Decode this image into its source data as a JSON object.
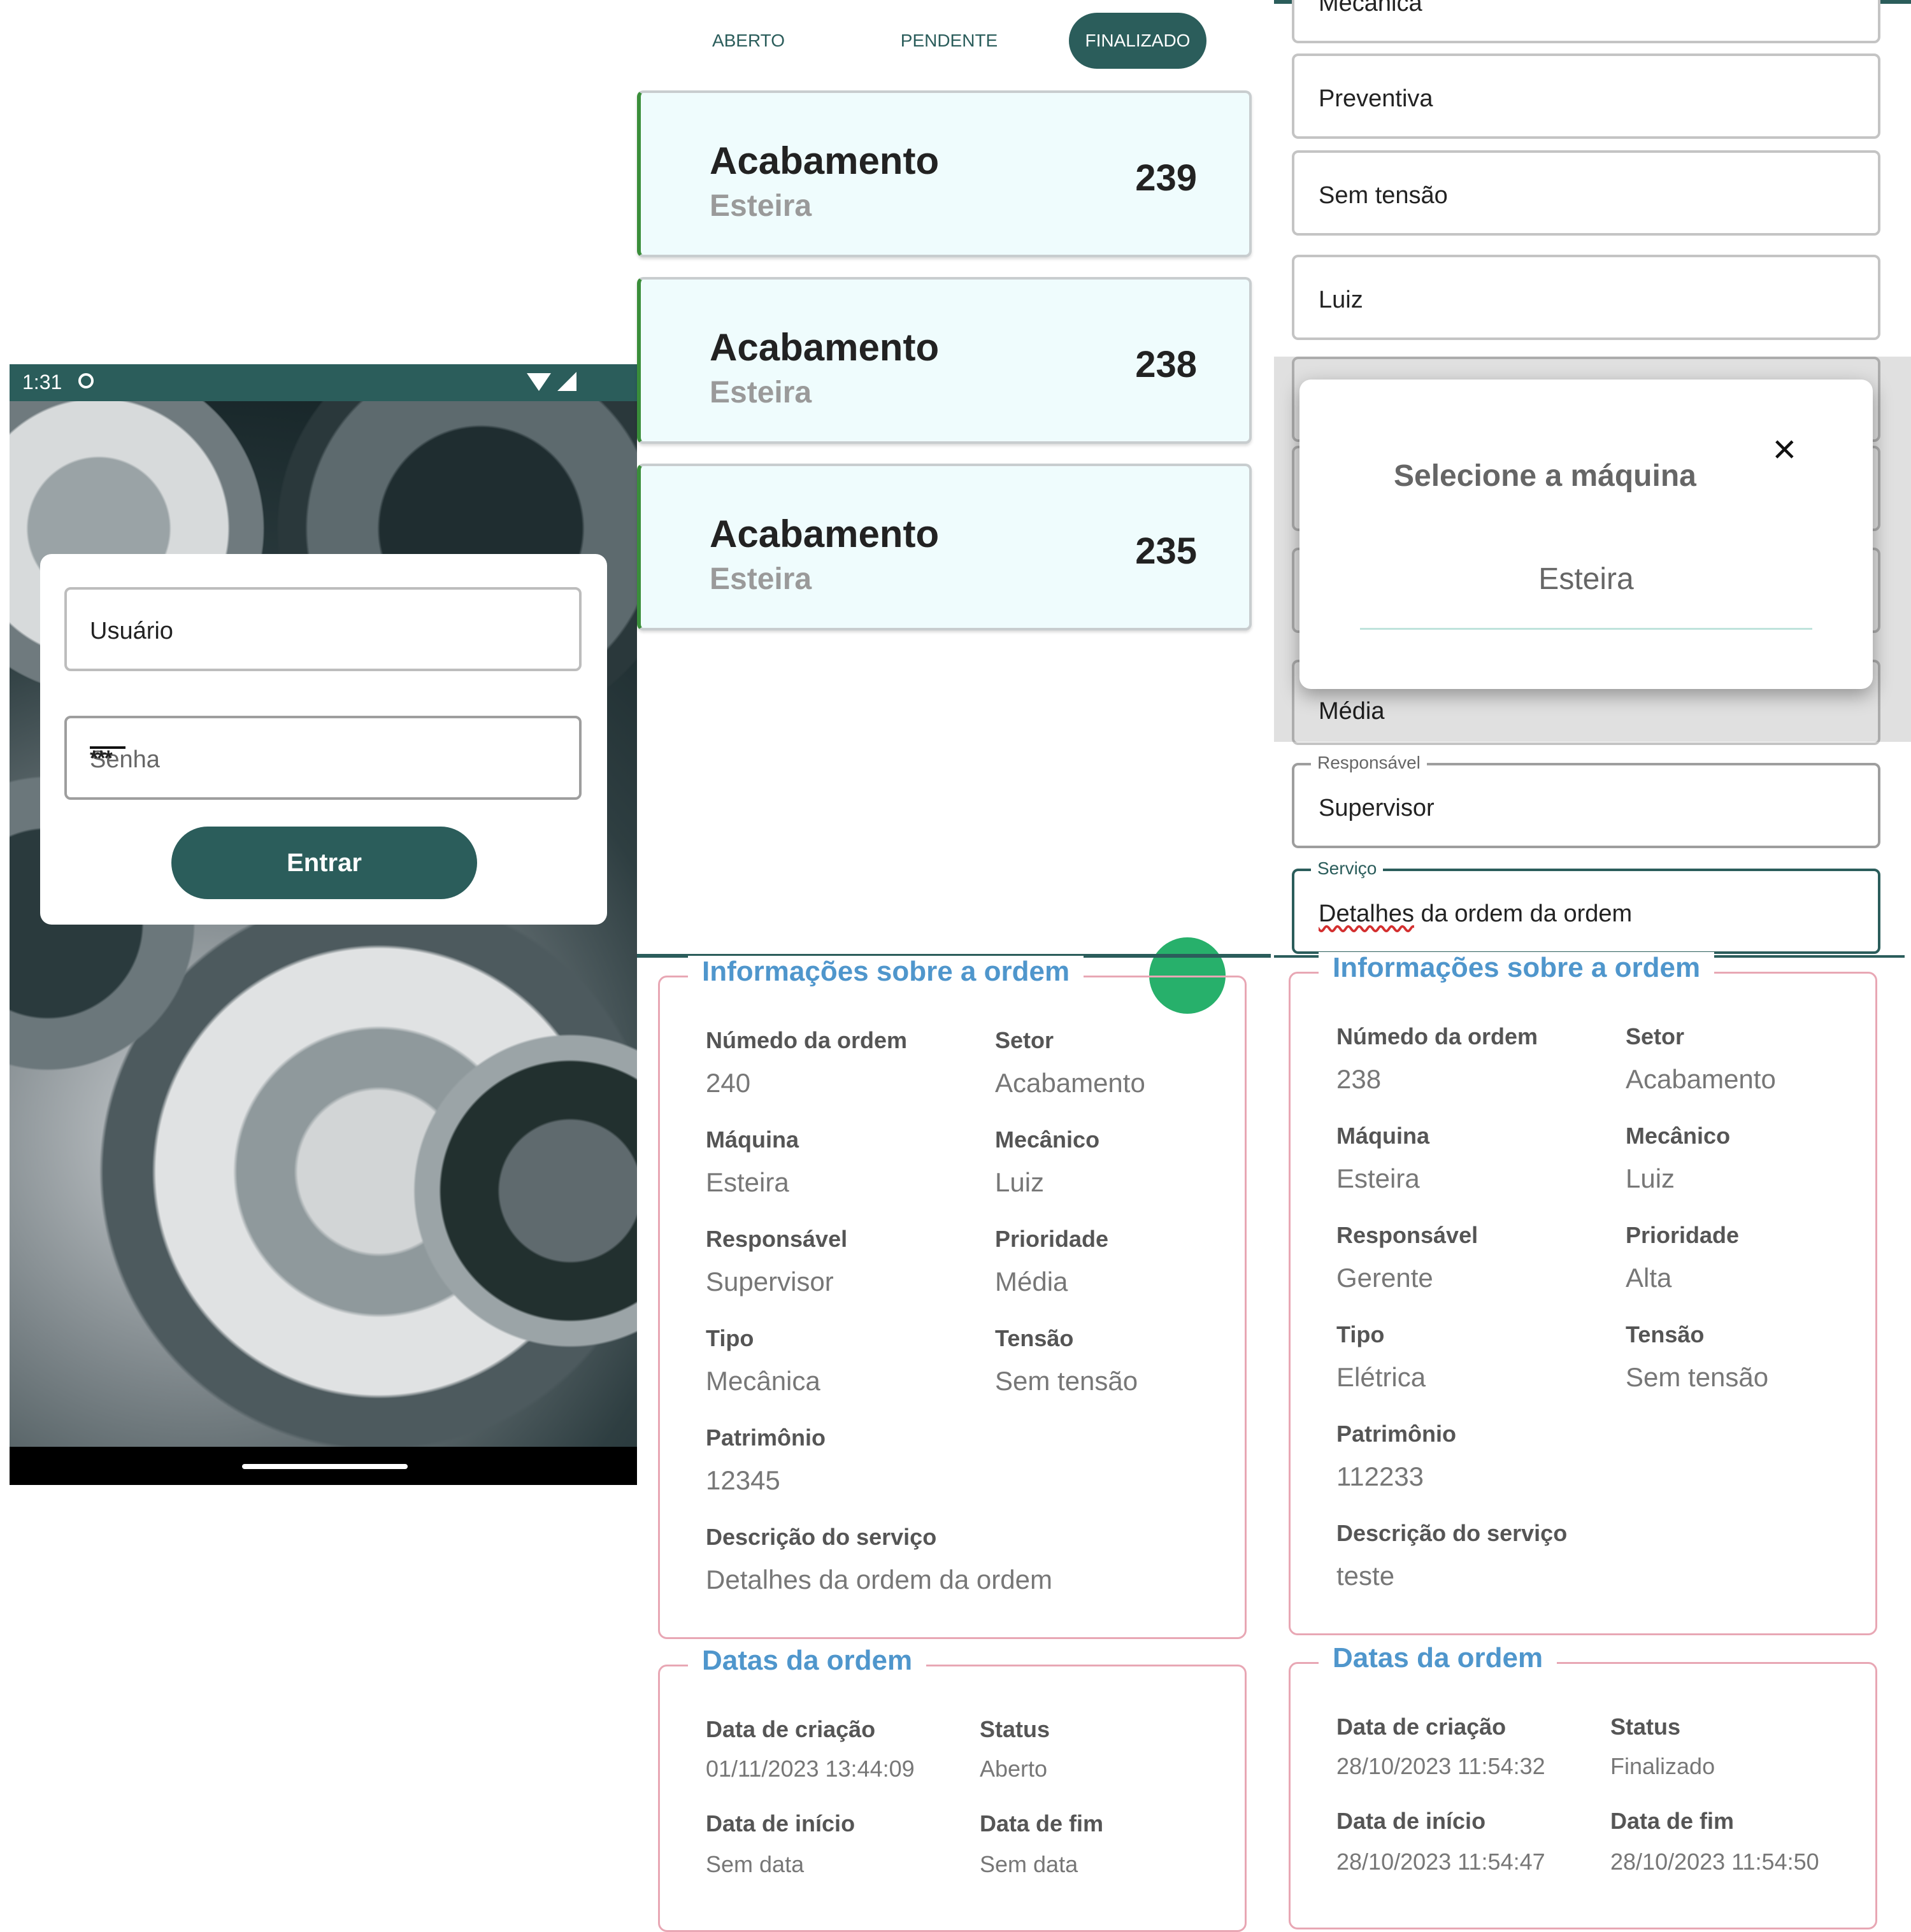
{
  "login": {
    "time": "1:31",
    "user_placeholder": "Usuário",
    "pass_placeholder": "Senha",
    "pass_icon": "***",
    "submit_label": "Entrar"
  },
  "tabs": [
    {
      "label": "ABERTO",
      "active": false
    },
    {
      "label": "PENDENTE",
      "active": false
    },
    {
      "label": "FINALIZADO",
      "active": true
    }
  ],
  "orders": [
    {
      "setor": "Acabamento",
      "maquina": "Esteira",
      "numero": "239"
    },
    {
      "setor": "Acabamento",
      "maquina": "Esteira",
      "numero": "238"
    },
    {
      "setor": "Acabamento",
      "maquina": "Esteira",
      "numero": "235"
    }
  ],
  "form": {
    "tipo_value": "Mecânica",
    "preventiva": "Preventiva",
    "tensao": "Sem tensão",
    "mecanico": "Luiz",
    "prioridade": "Média",
    "responsavel_label": "Responsável",
    "responsavel_value": "Supervisor",
    "servico_label": "Serviço",
    "servico_value_word1": "Detalhes",
    "servico_value_rest": " da ordem da ordem"
  },
  "dialog": {
    "title": "Selecione a máquina",
    "option": "Esteira",
    "close_icon": "×"
  },
  "labels": {
    "info_title": "Informações sobre a ordem",
    "numero": "Númedo da ordem",
    "setor": "Setor",
    "maquina": "Máquina",
    "mecanico": "Mecânico",
    "responsavel": "Responsável",
    "prioridade": "Prioridade",
    "tipo": "Tipo",
    "tensao": "Tensão",
    "patrimonio": "Patrimônio",
    "descricao": "Descrição do serviço",
    "datas_title": "Datas da ordem",
    "criacao": "Data de criação",
    "status": "Status",
    "inicio": "Data de início",
    "fim": "Data de fim"
  },
  "detail_a": {
    "numero": "240",
    "setor": "Acabamento",
    "maquina": "Esteira",
    "mecanico": "Luiz",
    "responsavel": "Supervisor",
    "prioridade": "Média",
    "tipo": "Mecânica",
    "tensao": "Sem tensão",
    "patrimonio": "12345",
    "descricao": "Detalhes da ordem da ordem",
    "criacao": "01/11/2023 13:44:09",
    "status": "Aberto",
    "inicio": "Sem data",
    "fim": "Sem data"
  },
  "detail_b": {
    "numero": "238",
    "setor": "Acabamento",
    "maquina": "Esteira",
    "mecanico": "Luiz",
    "responsavel": "Gerente",
    "prioridade": "Alta",
    "tipo": "Elétrica",
    "tensao": "Sem tensão",
    "patrimonio": "112233",
    "descricao": "teste",
    "criacao": "28/10/2023 11:54:32",
    "status": "Finalizado",
    "inicio": "28/10/2023 11:54:47",
    "fim": "28/10/2023 11:54:50"
  },
  "colors": {
    "primary": "#2b5d5b",
    "card_bg": "#effcfd",
    "card_accent": "#3a8e3a",
    "section_border": "#e8a7b4",
    "section_title": "#4f96cc",
    "fab": "#27b06b"
  }
}
